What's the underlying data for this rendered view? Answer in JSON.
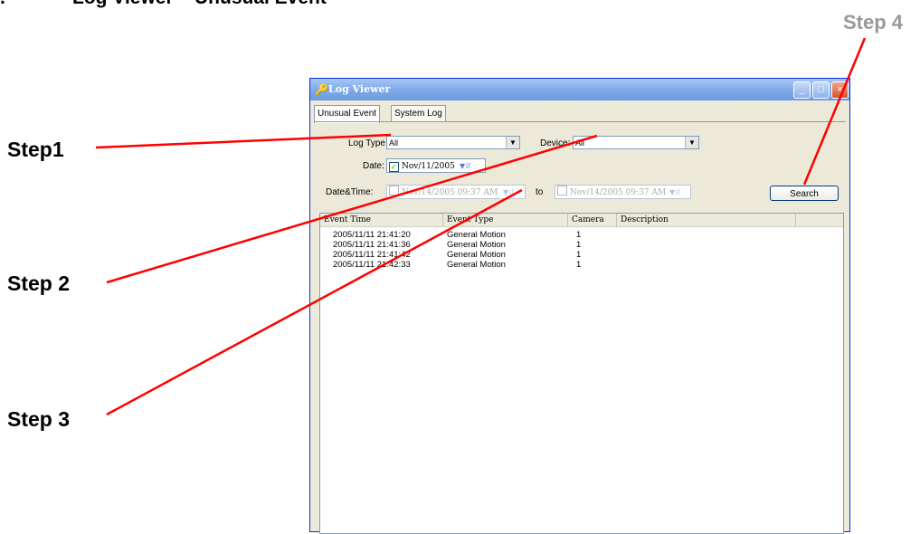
{
  "heading": {
    "number": ".",
    "title": "Log Viewer – Unusual Event"
  },
  "steps": {
    "step1": "Step1",
    "step2": "Step 2",
    "step3": "Step 3",
    "step4": "Step 4"
  },
  "window": {
    "title": "Log Viewer",
    "buttons": {
      "minimize": "_",
      "maximize": "□",
      "close": "×"
    }
  },
  "tabs": [
    {
      "label": "Unusual Event",
      "active": true
    },
    {
      "label": "System Log",
      "active": false
    }
  ],
  "filters": {
    "log_type_label": "Log Type:",
    "log_type_value": "All",
    "device_label": "Device:",
    "device_value": "All",
    "date_label": "Date:",
    "date_value": "Nov/11/2005",
    "date_checked": true,
    "datetime_label": "Date&Time:",
    "datetime_from": "Nov/14/2005 09:37 AM",
    "to_label": "to",
    "datetime_to": "Nov/14/2005 09:37 AM",
    "datetime_checked": false
  },
  "search_button": "Search",
  "table": {
    "columns": [
      "Event Time",
      "Event Type",
      "Camera",
      "Description"
    ],
    "rows": [
      {
        "time": "2005/11/11 21:41:20",
        "type": "General Motion",
        "camera": "1",
        "description": ""
      },
      {
        "time": "2005/11/11 21:41:36",
        "type": "General Motion",
        "camera": "1",
        "description": ""
      },
      {
        "time": "2005/11/11 21:41:42",
        "type": "General Motion",
        "camera": "1",
        "description": ""
      },
      {
        "time": "2005/11/11 21:42:33",
        "type": "General Motion",
        "camera": "1",
        "description": ""
      }
    ]
  },
  "colors": {
    "annotation_line": "#ff0000",
    "step4_text": "#999999"
  },
  "icons": {
    "app": "key-icon",
    "dropdown": "chevron-down-icon"
  }
}
